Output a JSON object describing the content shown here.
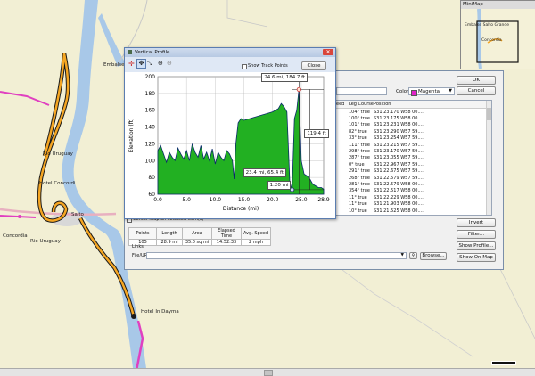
{
  "map": {
    "labels": {
      "embalse": "Embalse",
      "rio_uruguay_north": "Rio Uruguay",
      "hotel_concordia": "Hotel Concordi",
      "salto": "Salto",
      "concordia": "Concordia",
      "rio_uruguay_south": "Rio Uruguay",
      "hotel_in_dayma": "Hotel In Dayma"
    },
    "colors": {
      "land": "#f2efd4",
      "water": "#a8c8e8",
      "route": "#f5a623",
      "route_border": "#1a1a1a",
      "track": "#e040c0",
      "road_major": "#e8b0c0"
    }
  },
  "minimap": {
    "title": "MiniMap",
    "labels": {
      "embalse": "Embalse Salto Grande",
      "concordia": "Concordia"
    }
  },
  "track_properties": {
    "buttons": {
      "ok": "OK",
      "cancel": "Cancel",
      "invert": "Invert",
      "filter": "Filter...",
      "show_profile": "Show Profile...",
      "show_on_map": "Show On Map",
      "browse": "Browse..."
    },
    "color_label": "Color:",
    "color_value": "Magenta",
    "color_hex": "#e020c8",
    "table": {
      "headers": [
        "Leg Course",
        "Position"
      ],
      "first_col_header": "eed",
      "rows": [
        [
          "104° true",
          "S31 23.170 W58 00...."
        ],
        [
          "100° true",
          "S31 23.175 W58 00...."
        ],
        [
          "101° true",
          "S31 23.231 W58 00...."
        ],
        [
          "82° true",
          "S31 23.290 W57 59...."
        ],
        [
          "33° true",
          "S31 23.254 W57 59...."
        ],
        [
          "111° true",
          "S31 23.215 W57 59...."
        ],
        [
          "298° true",
          "S31 23.170 W57 59...."
        ],
        [
          "287° true",
          "S31 23.055 W57 59...."
        ],
        [
          "0° true",
          "S31 22.967 W57 59...."
        ],
        [
          "291° true",
          "S31 22.675 W57 59...."
        ],
        [
          "268° true",
          "S31 22.579 W57 59...."
        ],
        [
          "281° true",
          "S31 22.579 W58 00...."
        ],
        [
          "354° true",
          "S31 22.517 W58 00...."
        ],
        [
          "11° true",
          "S31 22.229 W58 00...."
        ],
        [
          "11° true",
          "S31 21.903 W58 00...."
        ],
        [
          "10° true",
          "S31 21.525 W58 00...."
        ]
      ]
    },
    "center_map_label": "Center map on selected item(s)",
    "stats": {
      "headers": [
        "Points",
        "Length",
        "Area",
        "Elapsed Time",
        "Avg. Speed"
      ],
      "values": [
        "105",
        "28.9 mi",
        "35.0 sq mi",
        "14:52:33",
        "2 mph"
      ]
    },
    "links_label": "Links",
    "file_url_label": "File/URL:"
  },
  "vertical_profile": {
    "title": "Vertical Profile",
    "show_track_points": "Show Track Points",
    "close": "Close",
    "callouts": {
      "top": "24.6 mi, 184.7 ft",
      "bottom": "23.4 mi, 65.4 ft",
      "vertical": "119.4 ft",
      "horizontal": "1.20 mi"
    }
  },
  "chart_data": {
    "type": "area",
    "xlabel": "Distance  (mi)",
    "ylabel": "Elevation (ft)",
    "xlim": [
      0,
      28.9
    ],
    "ylim": [
      60,
      200
    ],
    "xticks": [
      "0.0",
      "5.0",
      "10.0",
      "15.0",
      "20.0",
      "25.0",
      "28.9"
    ],
    "yticks": [
      "60",
      "80",
      "100",
      "120",
      "140",
      "160",
      "180",
      "200"
    ],
    "fill_color": "#22b022",
    "line_color": "#0a2a6a",
    "x": [
      0,
      0.5,
      1,
      1.5,
      2,
      2.5,
      3,
      3.5,
      4,
      4.5,
      5,
      5.5,
      6,
      6.5,
      7,
      7.5,
      8,
      8.5,
      9,
      9.5,
      10,
      10.5,
      11,
      11.5,
      12,
      12.5,
      13,
      13.3,
      13.6,
      14,
      14.5,
      15,
      16,
      17,
      18,
      19,
      20,
      21,
      21.5,
      22,
      22.5,
      23,
      23.4,
      23.8,
      24.2,
      24.6,
      25,
      25.5,
      26,
      26.5,
      27,
      27.5,
      28,
      28.5,
      28.9
    ],
    "y": [
      112,
      118,
      108,
      98,
      110,
      104,
      100,
      115,
      108,
      102,
      112,
      100,
      120,
      110,
      104,
      118,
      102,
      110,
      100,
      114,
      96,
      110,
      104,
      100,
      112,
      108,
      100,
      78,
      120,
      145,
      150,
      148,
      150,
      152,
      154,
      156,
      158,
      162,
      168,
      164,
      158,
      75,
      65,
      150,
      160,
      185,
      100,
      84,
      82,
      78,
      72,
      70,
      68,
      68,
      66
    ],
    "grid": true
  }
}
